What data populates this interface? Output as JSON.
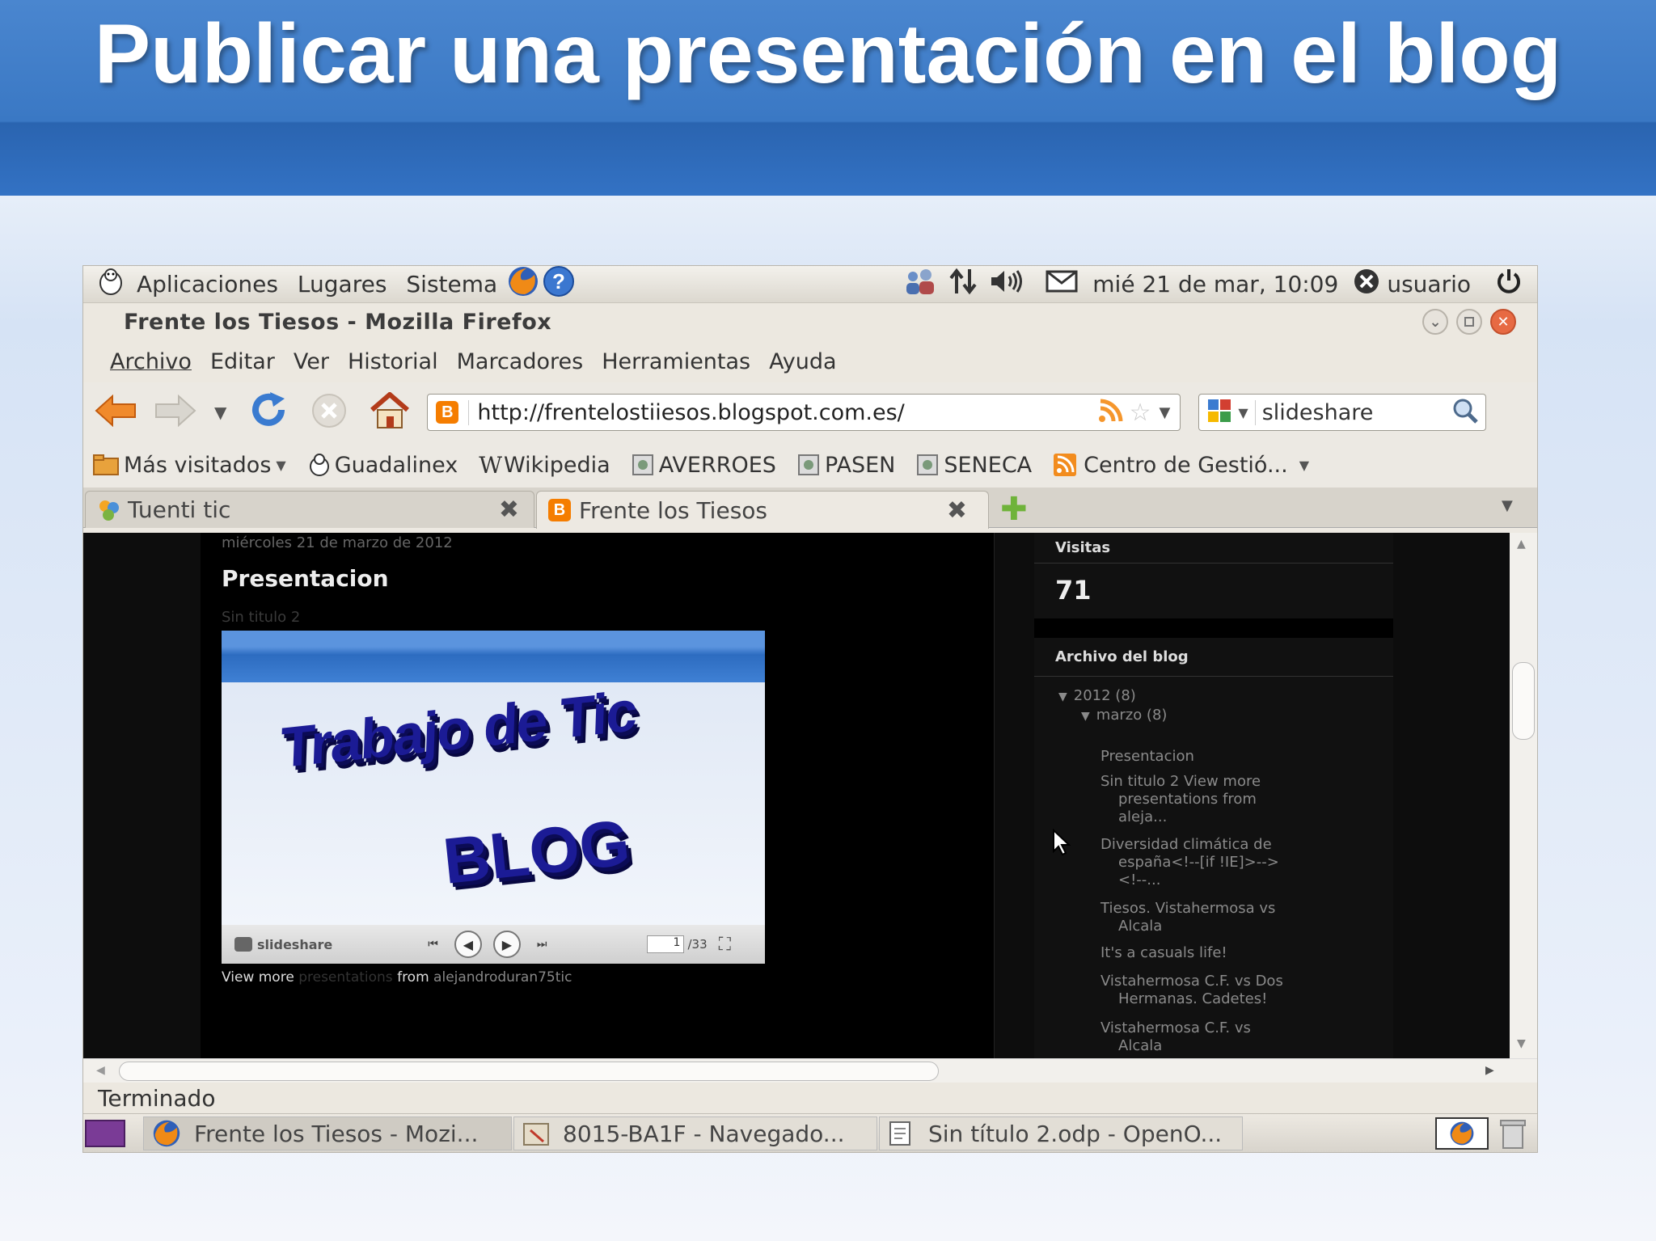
{
  "slide": {
    "title": "Publicar una presentación en el blog"
  },
  "gnome_panel": {
    "menus": [
      "Aplicaciones",
      "Lugares",
      "Sistema"
    ],
    "clock": "mié 21 de mar, 10:09",
    "user": "usuario"
  },
  "window": {
    "title": "Frente los Tiesos - Mozilla Firefox"
  },
  "menubar": [
    "Archivo",
    "Editar",
    "Ver",
    "Historial",
    "Marcadores",
    "Herramientas",
    "Ayuda"
  ],
  "navbar": {
    "url": "http://frentelostiiesos.blogspot.com.es/",
    "search": "slideshare"
  },
  "bookmarks": [
    "Más visitados",
    "Guadalinex",
    "Wikipedia",
    "AVERROES",
    "PASEN",
    "SENECA",
    "Centro de Gestió..."
  ],
  "tabs": [
    "Tuenti tic",
    "Frente los Tiesos"
  ],
  "blog": {
    "date": "miércoles 21 de marzo de 2012",
    "post_title": "Presentacion",
    "post_subtitle": "Sin titulo 2",
    "embed_slide": {
      "text_line1": "Trabajo de Tic",
      "text_line2": "BLOG"
    },
    "player": {
      "brand": "slideshare",
      "page": "1",
      "total": "/33"
    },
    "view_more": {
      "a": "View",
      "b": "more",
      "c": "presentations",
      "d": "from",
      "e": "alejandroduran75tic"
    },
    "visits": {
      "label": "Visitas",
      "count": "71"
    },
    "archive": {
      "label": "Archivo del blog",
      "year": "2012 (8)",
      "month": "marzo (8)",
      "posts": [
        [
          "Presentacion"
        ],
        [
          "Sin titulo 2 View more",
          "presentations from",
          "aleja..."
        ],
        [
          "Diversidad climática de",
          "españa<!--[if !IE]>-->",
          "<!--..."
        ],
        [
          "Tiesos. Vistahermosa vs",
          "Alcala"
        ],
        [
          "It's a casuals life!"
        ],
        [
          "Vistahermosa C.F. vs Dos",
          "Hermanas. Cadetes!"
        ],
        [
          "Vistahermosa C.F. vs",
          "Alcala"
        ]
      ]
    }
  },
  "status": "Terminado",
  "taskbar": [
    "Frente los Tiesos - Mozi...",
    "8015-BA1F - Navegado...",
    "Sin título 2.odp - OpenO..."
  ]
}
